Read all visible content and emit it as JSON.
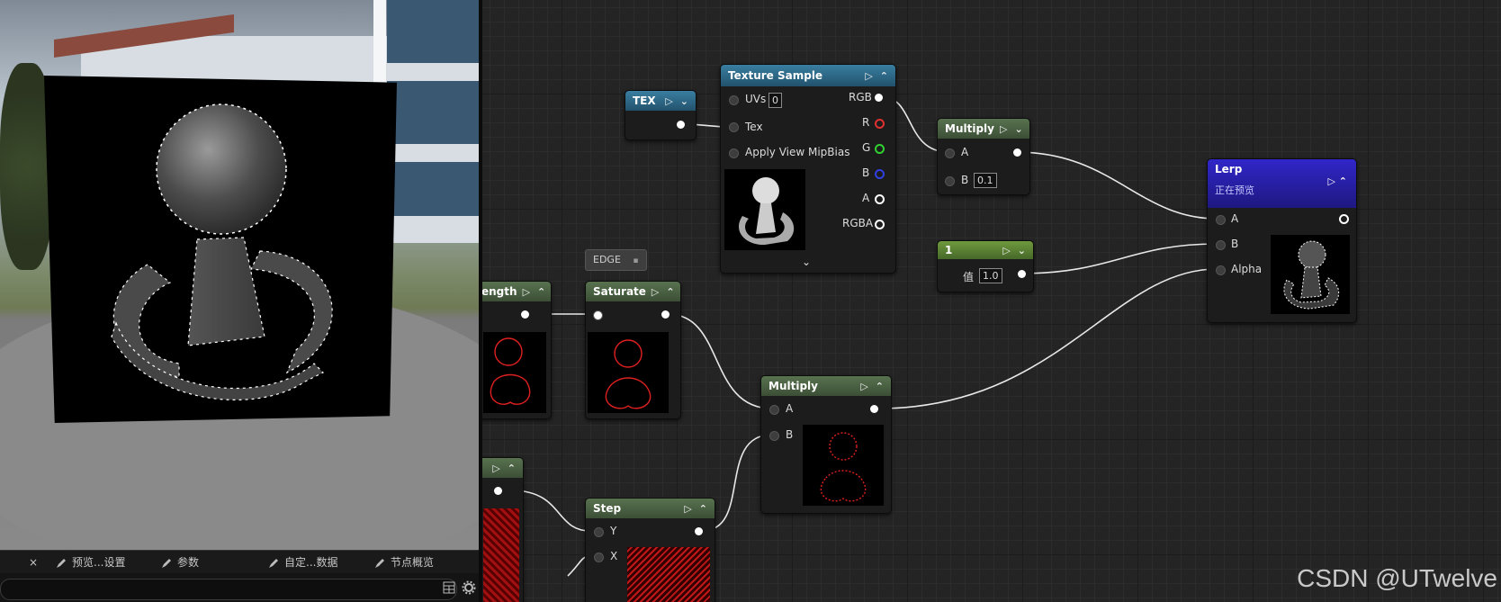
{
  "preview_tabs": {
    "close_label": "×",
    "preview_settings": "预览...设置",
    "parameters": "参数",
    "custom_data": "自定...数据",
    "node_overview": "节点概览"
  },
  "graph": {
    "tex_node": {
      "title": "TEX"
    },
    "texture_sample": {
      "title": "Texture Sample",
      "inputs": [
        "UVs",
        "Tex",
        "Apply View MipBias"
      ],
      "uv_value": "0",
      "outputs": [
        "RGB",
        "R",
        "G",
        "B",
        "A",
        "RGBA"
      ]
    },
    "multiply_top": {
      "title": "Multiply",
      "input_a": "A",
      "input_b": "B",
      "b_value": "0.1"
    },
    "constant": {
      "title": "1",
      "value_label": "值",
      "value": "1.0"
    },
    "lerp": {
      "title": "Lerp",
      "subtitle": "正在预览",
      "inputs": [
        "A",
        "B",
        "Alpha"
      ]
    },
    "length_node": {
      "title": "ength"
    },
    "saturate": {
      "title": "Saturate"
    },
    "comment": {
      "label": "EDGE"
    },
    "multiply_mid": {
      "title": "Multiply",
      "input_a": "A",
      "input_b": "B"
    },
    "step": {
      "title": "Step",
      "input_y": "Y",
      "input_x": "X"
    },
    "pin_colors": {
      "r": "#e03030",
      "g": "#30d030",
      "b": "#3040e0"
    }
  },
  "watermark": "CSDN @UTwelve"
}
